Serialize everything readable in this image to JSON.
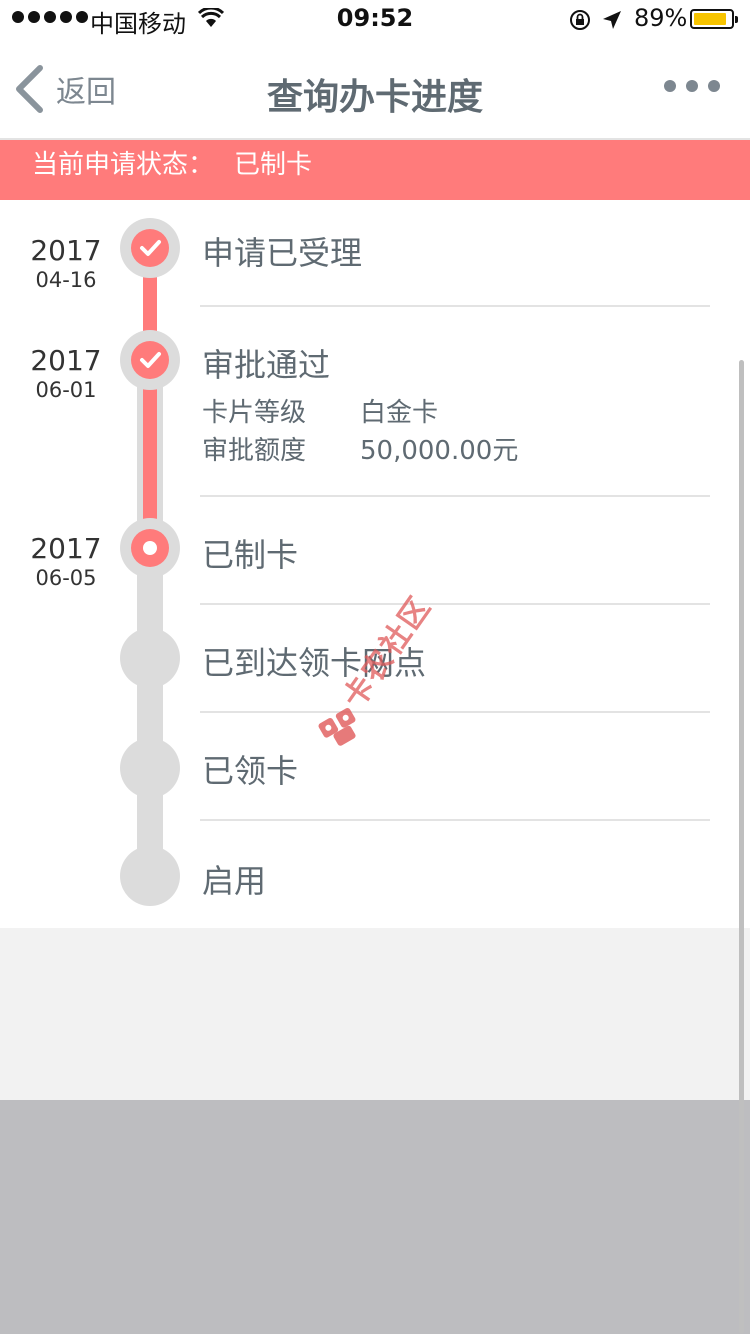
{
  "status_bar": {
    "carrier": "中国移动",
    "time": "09:52",
    "battery": "89%",
    "battery_level": 0.89,
    "battery_color": "#f7c400"
  },
  "nav": {
    "back_label": "返回",
    "title": "查询办卡进度",
    "more_icon": "more-dots-icon"
  },
  "banner": {
    "label": "当前申请状态：",
    "value": "已制卡",
    "color": "#ff7b7b"
  },
  "timeline": {
    "accent_color": "#ff7b7b",
    "steps": [
      {
        "title": "申请已受理",
        "year": "2017",
        "date": "04-16",
        "state": "done"
      },
      {
        "title": "审批通过",
        "year": "2017",
        "date": "06-01",
        "state": "done",
        "details": [
          {
            "label": "卡片等级",
            "value": "白金卡"
          },
          {
            "label": "审批额度",
            "value": "50,000.00元"
          }
        ]
      },
      {
        "title": "已制卡",
        "year": "2017",
        "date": "06-05",
        "state": "current"
      },
      {
        "title": "已到达领卡网点",
        "state": "pending"
      },
      {
        "title": "已领卡",
        "state": "pending"
      },
      {
        "title": "启用",
        "state": "pending"
      }
    ]
  },
  "watermark": {
    "text": "卡农社区"
  }
}
